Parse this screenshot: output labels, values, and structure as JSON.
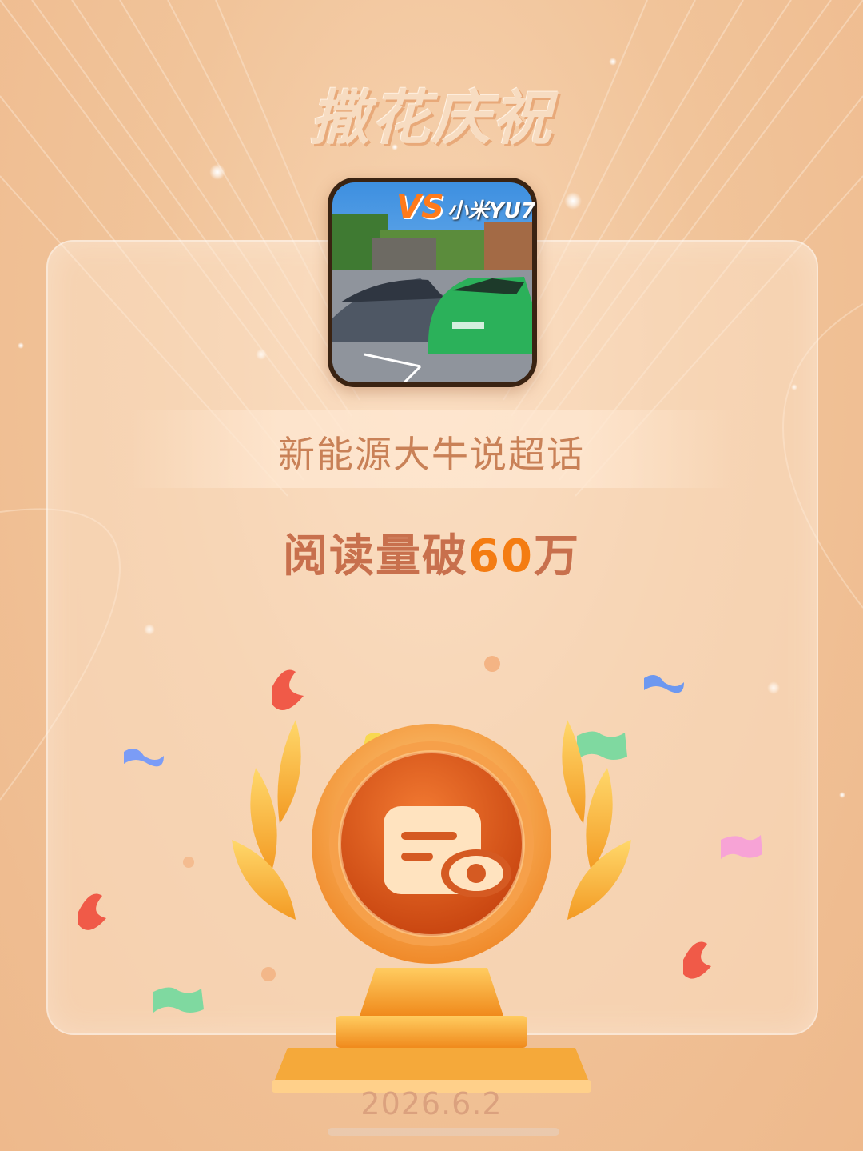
{
  "header": {
    "title": "撒花庆祝"
  },
  "post": {
    "thumbnail": {
      "badge": "VS",
      "caption": "小米YU7",
      "description": "photo of a grey car and a green car parked side by side"
    },
    "topic": "新能源大牛说超话"
  },
  "achievement": {
    "prefix": "阅读量破",
    "number": "60",
    "unit": "万",
    "badge_icon": "document-eye-icon"
  },
  "footer": {
    "date": "2026.6.2"
  },
  "colors": {
    "background": "#f1c49a",
    "accent_orange": "#f47c12",
    "title_text": "#c8704d",
    "topic_text": "#c98157",
    "date_text": "#dba17e"
  }
}
